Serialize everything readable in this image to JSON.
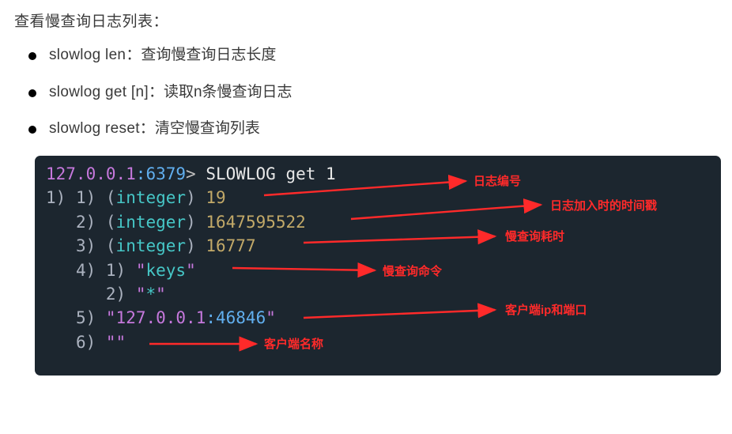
{
  "heading": "查看慢查询日志列表：",
  "commands": [
    {
      "name": "slowlog len",
      "sep": "：",
      "desc": "查询慢查询日志长度"
    },
    {
      "name": "slowlog get [n]",
      "sep": "：",
      "desc": "读取n条慢查询日志"
    },
    {
      "name": "slowlog reset",
      "sep": "：",
      "desc": "清空慢查询列表"
    }
  ],
  "terminal": {
    "prompt_host": "127.0.0.1",
    "prompt_port": "6379",
    "command": "SLOWLOG get 1",
    "result": {
      "idx_outer": "1)",
      "line1_idx": "1)",
      "line1_type": "integer",
      "line1_val": "19",
      "line2_idx": "2)",
      "line2_type": "integer",
      "line2_val": "1647595522",
      "line3_idx": "3)",
      "line3_type": "integer",
      "line3_val": "16777",
      "line4_idx": "4)",
      "line4_sub1_idx": "1)",
      "line4_sub1_val": "keys",
      "line4_sub2_idx": "2)",
      "line4_sub2_val": "*",
      "line5_idx": "5)",
      "line5_ip": "127.0.0.1",
      "line5_port": "46846",
      "line6_idx": "6)",
      "line6_val": ""
    }
  },
  "annotations": {
    "a1": "日志编号",
    "a2": "日志加入时的时间戳",
    "a3": "慢查询耗时",
    "a4": "慢查询命令",
    "a5": "客户端ip和端口",
    "a6": "客户端名称"
  }
}
